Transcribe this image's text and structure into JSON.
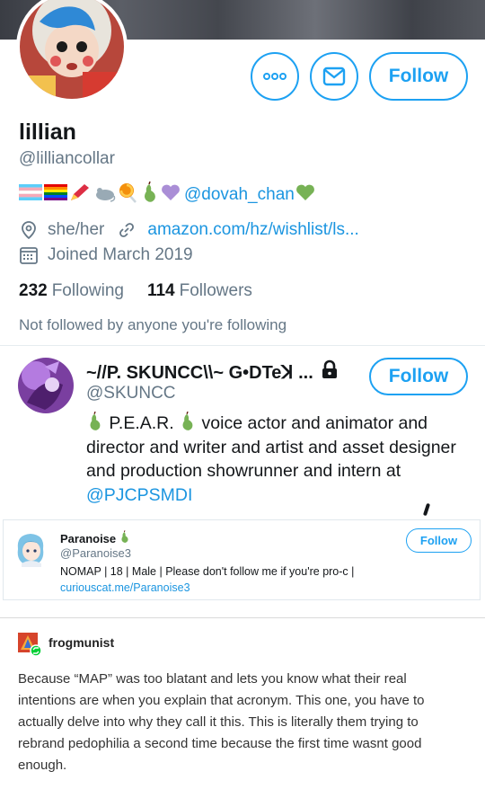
{
  "profile": {
    "name": "lillian",
    "handle": "@lilliancollar",
    "bio_emojis": [
      "transgender-flag",
      "rainbow-flag",
      "red-pencil",
      "mouse",
      "lollipop",
      "pear",
      "purple-heart"
    ],
    "bio_mention": "@dovah_chan",
    "bio_end_emoji": "green-heart",
    "pronouns": "she/her",
    "website": "amazon.com/hz/wishlist/ls...",
    "joined": "Joined March 2019",
    "following_count": "232",
    "following_label": "Following",
    "followers_count": "114",
    "followers_label": "Followers",
    "not_followed": "Not followed by anyone you're following",
    "follow_label": "Follow"
  },
  "suggested_1": {
    "name": "~//P. SKUNCC\\\\~ G•DTeꓘ ...",
    "handle": "@SKUNCC",
    "follow_label": "Follow",
    "bio_part1": "P.E.A.R.",
    "bio_part2": "voice actor and animator and director and writer and artist and asset designer and production showrunner and intern at ",
    "bio_mention": "@PJCPSMDI"
  },
  "suggested_2": {
    "name": "Paranoise",
    "handle": "@Paranoise3",
    "bio": "NOMAP | 18 | Male | Please don't follow me if you're pro-c |",
    "link": "curiouscat.me/Paranoise3",
    "follow_label": "Follow"
  },
  "post": {
    "username": "frogmunist",
    "text": "Because “MAP” was too blatant and lets you know what their real intentions are when you explain that acronym. This one, you have to actually delve into why they call it this. This is literally them trying to rebrand pedophilia a second time because the first time wasnt good enough."
  },
  "colors": {
    "accent": "#1da1f2",
    "link": "#1b95e0",
    "secondary_text": "#657786",
    "primary_text": "#14171a"
  }
}
